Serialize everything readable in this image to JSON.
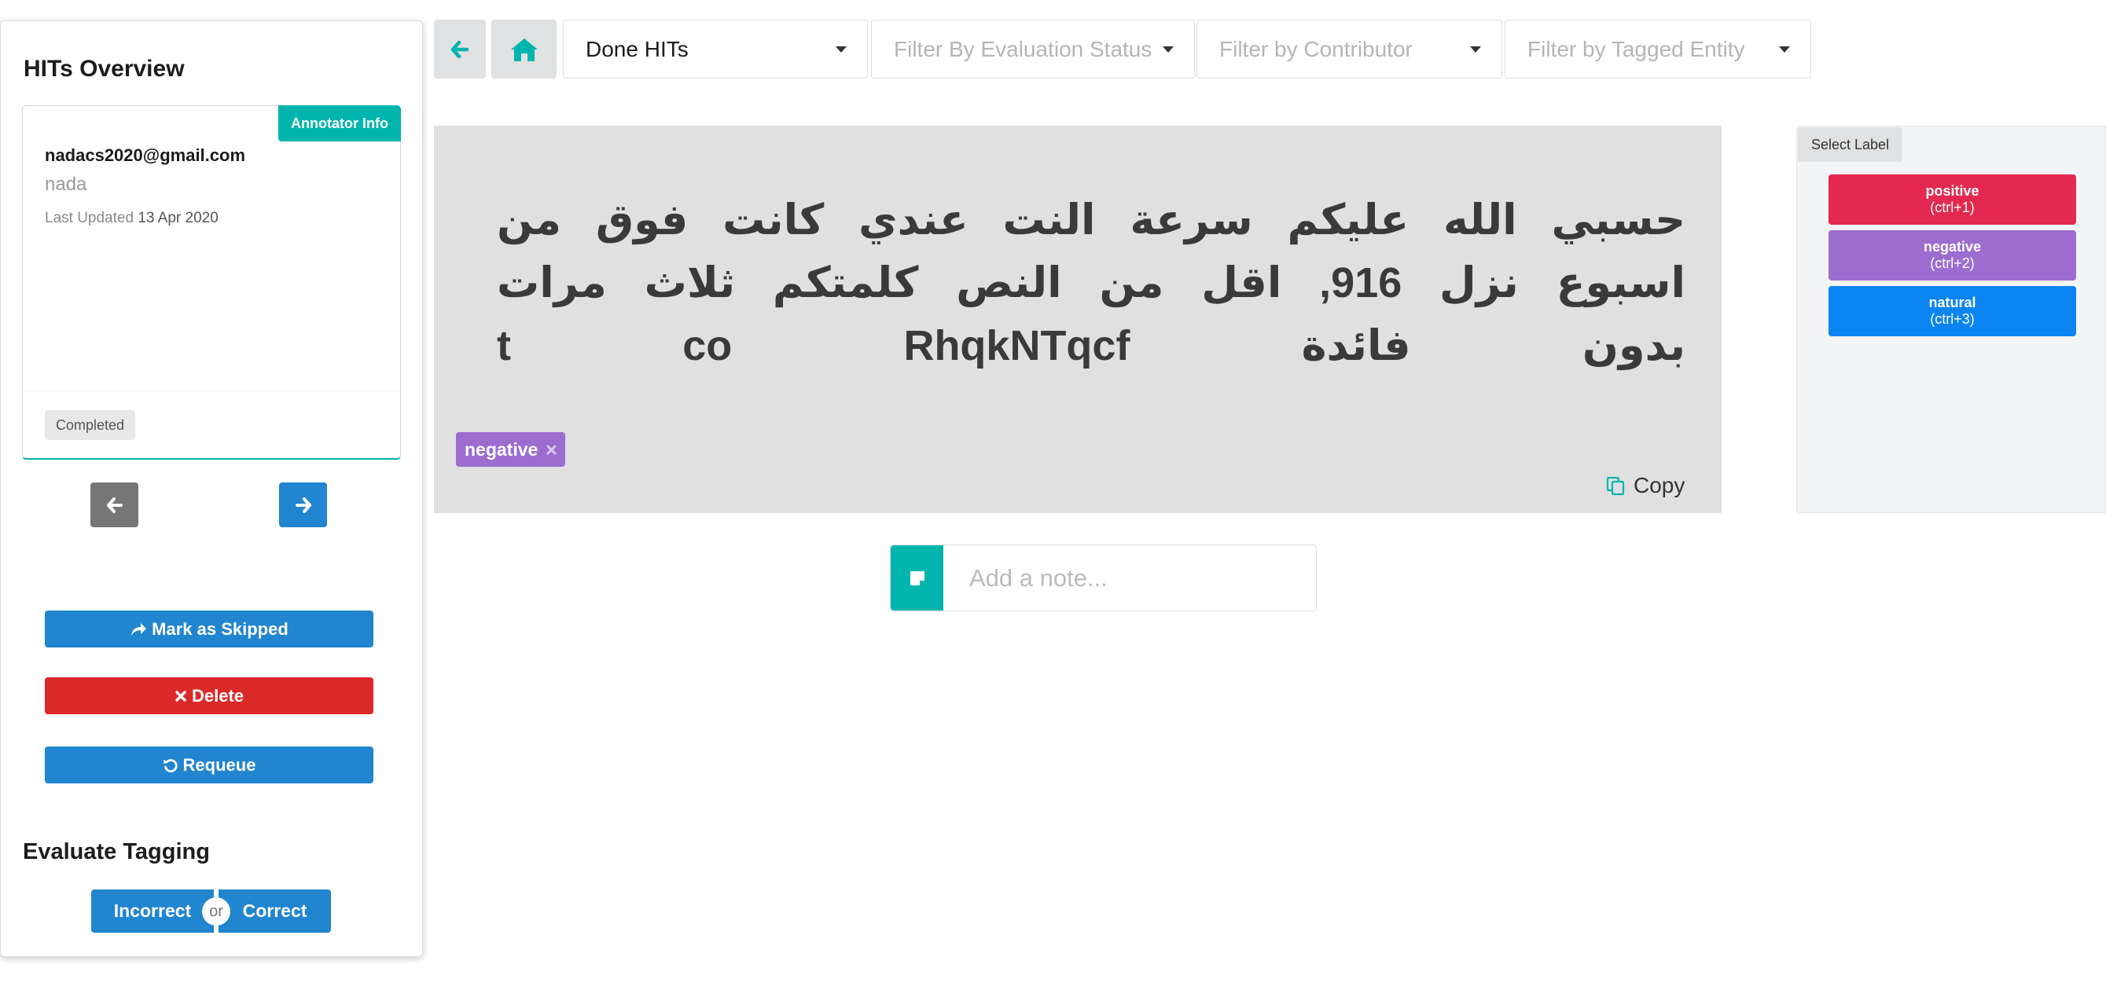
{
  "sidebar": {
    "title": "HITs Overview",
    "annotator_label": "Annotator Info",
    "email": "nadacs2020@gmail.com",
    "name": "nada",
    "last_updated_label": "Last Updated",
    "last_updated_date": "13 Apr 2020",
    "status": "Completed",
    "prev_icon": "arrow-left-icon",
    "next_icon": "arrow-right-icon",
    "actions": {
      "skip": "Mark as Skipped",
      "delete": "Delete",
      "requeue": "Requeue"
    },
    "evaluate": {
      "title": "Evaluate Tagging",
      "incorrect": "Incorrect",
      "or": "or",
      "correct": "Correct"
    }
  },
  "toolbar": {
    "back_icon": "arrow-left-icon",
    "home_icon": "home-icon",
    "hits_filter": "Done HITs",
    "eval_filter_placeholder": "Filter By Evaluation Status",
    "contributor_filter_placeholder": "Filter by Contributor",
    "entity_filter_placeholder": "Filter by Tagged Entity"
  },
  "document": {
    "text": "حسبي الله عليكم سرعة النت عندي كانت فوق من اسبوع نزل 916, اقل من النص كلمتكم ثلاث مرات بدون فائدة t co RhqkNTqcf",
    "tag": "negative",
    "copy_label": "Copy"
  },
  "note": {
    "placeholder": "Add a note..."
  },
  "labels": {
    "title": "Select Label",
    "items": [
      {
        "name": "positive",
        "shortcut": "(ctrl+1)",
        "color": "#e3294f"
      },
      {
        "name": "negative",
        "shortcut": "(ctrl+2)",
        "color": "#9c6ccf"
      },
      {
        "name": "natural",
        "shortcut": "(ctrl+3)",
        "color": "#0a84f0"
      }
    ]
  },
  "colors": {
    "teal": "#00b5ad",
    "blue": "#2185d0",
    "red": "#db2828",
    "grey": "#767676"
  }
}
